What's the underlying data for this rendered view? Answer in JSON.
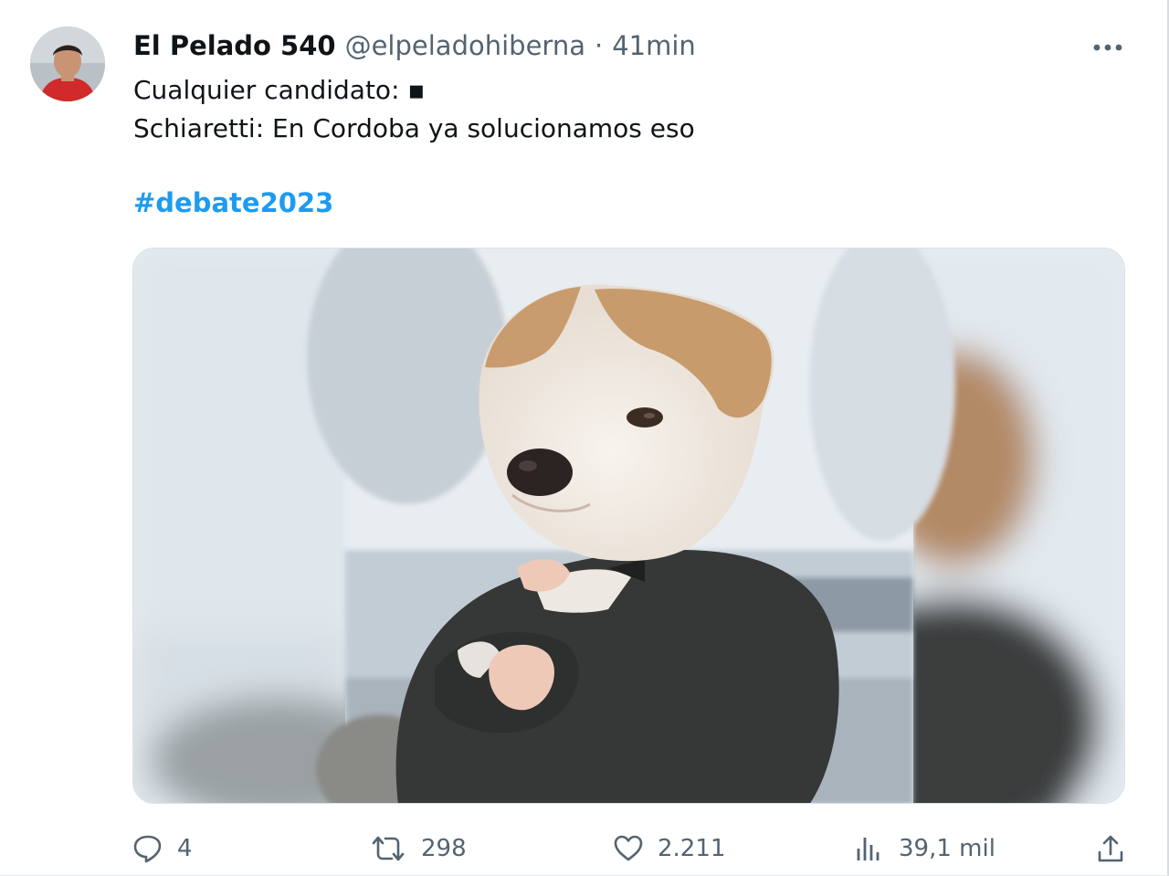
{
  "tweet": {
    "display_name": "El Pelado 540",
    "handle": "@elpeladohiberna",
    "separator": "·",
    "time": "41min",
    "line1": "Cualquier candidato: ▪",
    "line2": "Schiaretti: En Cordoba ya solucionamos eso",
    "hashtag": "#debate2023"
  },
  "actions": {
    "replies": "4",
    "retweets": "298",
    "likes": "2.211",
    "views": "39,1 mil"
  },
  "icons": {
    "more": "more-horizontal-icon",
    "reply": "reply-icon",
    "retweet": "retweet-icon",
    "like": "heart-icon",
    "views": "views-chart-icon",
    "share": "share-upload-icon"
  },
  "colors": {
    "link": "#1d9bf0",
    "secondary_text": "#536471",
    "primary_text": "#0f1419"
  }
}
